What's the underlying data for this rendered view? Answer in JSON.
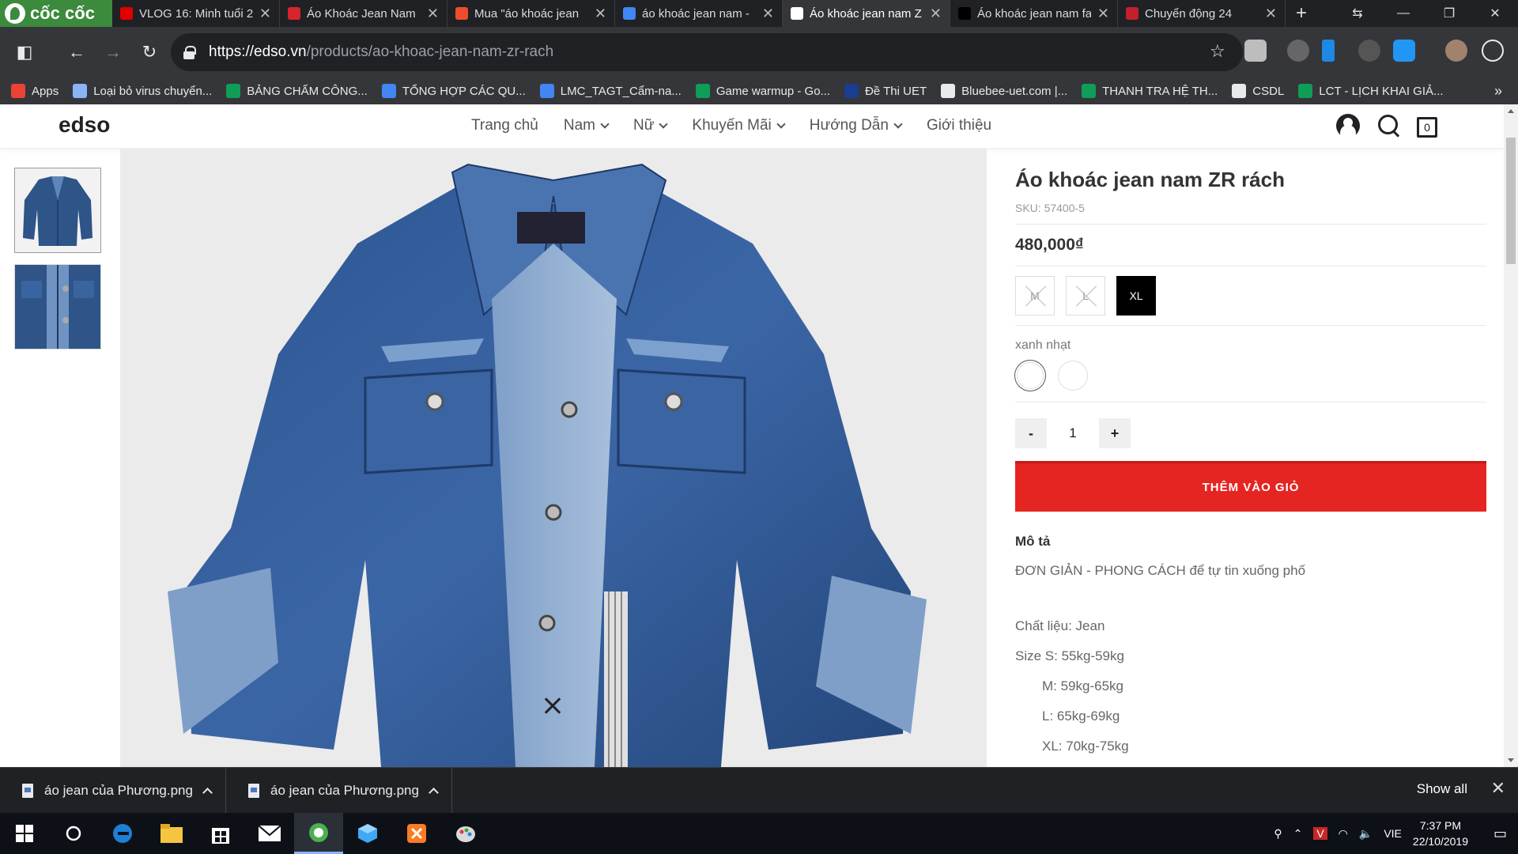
{
  "browser": {
    "brand": "cốc cốc",
    "tabs": [
      {
        "title": "VLOG 16: Minh tuổi 2",
        "color": "#e00000"
      },
      {
        "title": "Áo Khoác Jean Nam",
        "color": "#d8242c"
      },
      {
        "title": "Mua \"áo khoác jean",
        "color": "#ee4d2d"
      },
      {
        "title": "áo khoác jean nam -",
        "color": "#4285f4"
      },
      {
        "title": "Áo khoác jean nam Z",
        "color": "#ffffff",
        "active": true
      },
      {
        "title": "Áo khoác jean nam fa",
        "color": "#000000"
      },
      {
        "title": "Chuyển động 24",
        "color": "#c3202d"
      }
    ],
    "new_tab": "+",
    "url_host": "https://edso.vn",
    "url_path": "/products/ao-khoac-jean-nam-zr-rach",
    "bookmarks": [
      {
        "label": "Apps",
        "color": "#ea4335"
      },
      {
        "label": "Loại bỏ virus chuyển...",
        "color": "#8ab4f8"
      },
      {
        "label": "BẢNG CHẤM CÔNG...",
        "color": "#0f9d58"
      },
      {
        "label": "TỔNG HỢP CÁC QU...",
        "color": "#4285f4"
      },
      {
        "label": "LMC_TAGT_Cẩm-na...",
        "color": "#4285f4"
      },
      {
        "label": "Game warmup - Go...",
        "color": "#0f9d58"
      },
      {
        "label": "Đề Thi UET",
        "color": "#1a3d8f"
      },
      {
        "label": "Bluebee-uet.com |...",
        "color": "#e8eaed"
      },
      {
        "label": "THANH TRA HỆ TH...",
        "color": "#0f9d58"
      },
      {
        "label": "CSDL",
        "color": "#e8eaed"
      },
      {
        "label": "LCT - LỊCH KHAI GIẢ...",
        "color": "#0f9d58"
      }
    ],
    "more": "»"
  },
  "site": {
    "logo": "edso",
    "nav": [
      {
        "label": "Trang chủ",
        "dropdown": false
      },
      {
        "label": "Nam",
        "dropdown": true
      },
      {
        "label": "Nữ",
        "dropdown": true
      },
      {
        "label": "Khuyến Mãi",
        "dropdown": true
      },
      {
        "label": "Hướng Dẫn",
        "dropdown": true
      },
      {
        "label": "Giới thiệu",
        "dropdown": false
      }
    ],
    "cart_count": "0"
  },
  "product": {
    "title": "Áo khoác jean nam ZR rách",
    "sku": "SKU: 57400-5",
    "price": "480,000₫",
    "sizes": [
      {
        "label": "M",
        "state": "disabled"
      },
      {
        "label": "L",
        "state": "disabled"
      },
      {
        "label": "XL",
        "state": "selected"
      }
    ],
    "color_label": "xanh nhạt",
    "quantity": "1",
    "qty_minus": "-",
    "qty_plus": "+",
    "add_to_cart": "THÊM VÀO GIỎ",
    "desc_heading": "Mô tả",
    "desc_lines": [
      "ĐƠN GIẢN - PHONG CÁCH để tự tin xuống phố",
      "Chất liệu: Jean",
      "Size S: 55kg-59kg",
      "M: 59kg-65kg",
      "L: 65kg-69kg",
      "XL: 70kg-75kg"
    ],
    "denim_color": "#2e5488"
  },
  "downloads": {
    "items": [
      "áo jean của Phương.png",
      "áo jean của Phương.png"
    ],
    "show_all": "Show all",
    "close": "✕"
  },
  "taskbar": {
    "lang": "VIE",
    "time": "7:37 PM",
    "date": "22/10/2019"
  }
}
